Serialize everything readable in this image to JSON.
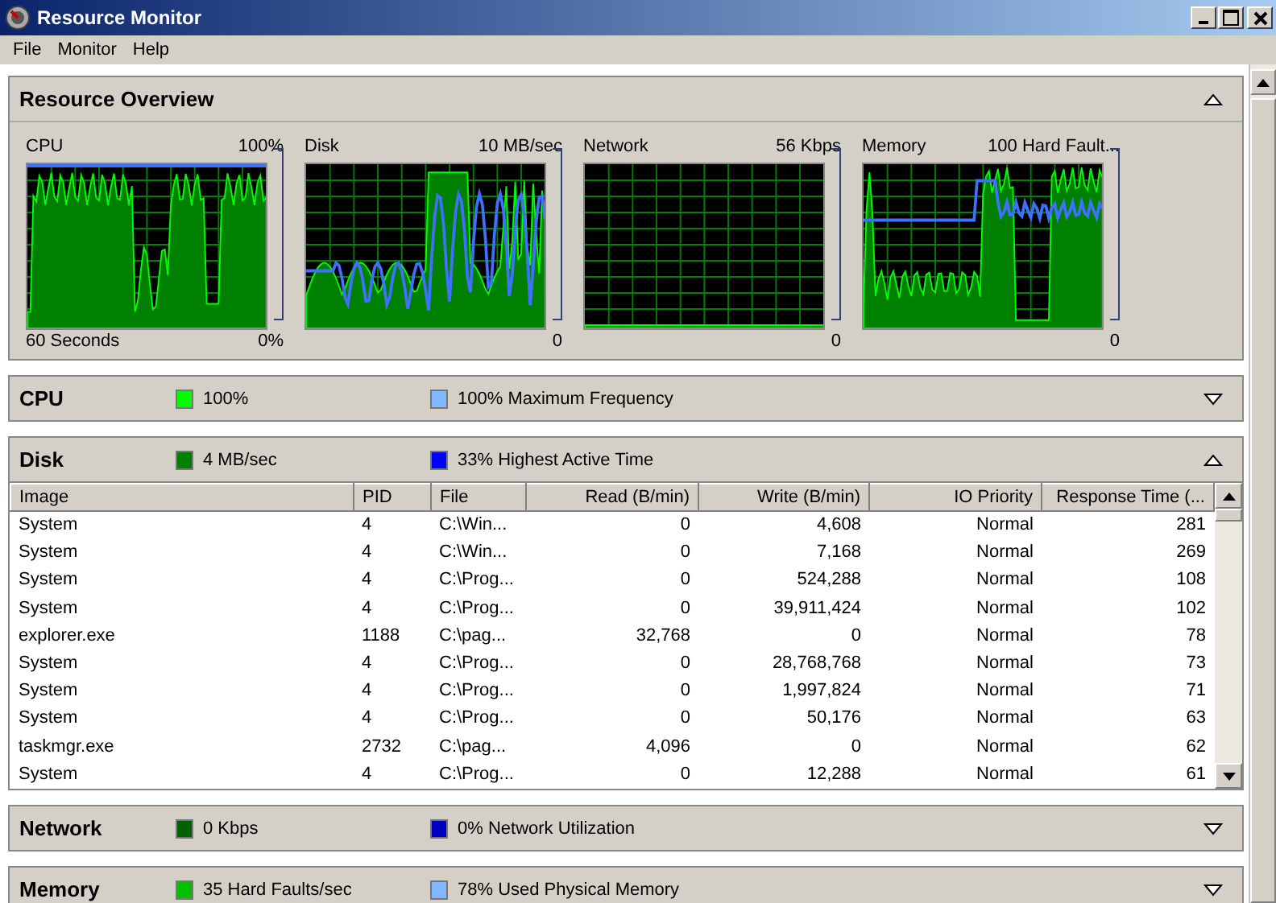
{
  "window": {
    "title": "Resource Monitor"
  },
  "menu": [
    "File",
    "Monitor",
    "Help"
  ],
  "overview": {
    "title": "Resource Overview",
    "expanded": true,
    "graphs": [
      {
        "title": "CPU",
        "max": "100%",
        "time": "60 Seconds",
        "min": "0%"
      },
      {
        "title": "Disk",
        "max": "10 MB/sec",
        "min": "0"
      },
      {
        "title": "Network",
        "max": "56 Kbps",
        "min": "0"
      },
      {
        "title": "Memory",
        "max": "100 Hard Fault...",
        "min": "0"
      }
    ]
  },
  "sections": [
    {
      "title": "CPU",
      "expanded": false,
      "legend": [
        {
          "text": "100%",
          "color": "#00ff00"
        },
        {
          "text": "100% Maximum Frequency",
          "color": "#80b8ff"
        }
      ]
    },
    {
      "title": "Disk",
      "expanded": true,
      "legend": [
        {
          "text": "4 MB/sec",
          "color": "#008000"
        },
        {
          "text": "33% Highest Active Time",
          "color": "#0000ff"
        }
      ],
      "table": {
        "columns": [
          "Image",
          "PID",
          "File",
          "Read (B/min)",
          "Write (B/min)",
          "IO Priority",
          "Response Time (..."
        ],
        "rows": [
          [
            "System",
            "4",
            "C:\\Win...",
            "0",
            "4,608",
            "Normal",
            "281"
          ],
          [
            "System",
            "4",
            "C:\\Win...",
            "0",
            "7,168",
            "Normal",
            "269"
          ],
          [
            "System",
            "4",
            "C:\\Prog...",
            "0",
            "524,288",
            "Normal",
            "108"
          ],
          [
            "System",
            "4",
            "C:\\Prog...",
            "0",
            "39,911,424",
            "Normal",
            "102"
          ],
          [
            "explorer.exe",
            "1188",
            "C:\\pag...",
            "32,768",
            "0",
            "Normal",
            "78"
          ],
          [
            "System",
            "4",
            "C:\\Prog...",
            "0",
            "28,768,768",
            "Normal",
            "73"
          ],
          [
            "System",
            "4",
            "C:\\Prog...",
            "0",
            "1,997,824",
            "Normal",
            "71"
          ],
          [
            "System",
            "4",
            "C:\\Prog...",
            "0",
            "50,176",
            "Normal",
            "63"
          ],
          [
            "taskmgr.exe",
            "2732",
            "C:\\pag...",
            "4,096",
            "0",
            "Normal",
            "62"
          ],
          [
            "System",
            "4",
            "C:\\Prog...",
            "0",
            "12,288",
            "Normal",
            "61"
          ]
        ]
      }
    },
    {
      "title": "Network",
      "expanded": false,
      "legend": [
        {
          "text": "0 Kbps",
          "color": "#006000"
        },
        {
          "text": "0% Network Utilization",
          "color": "#0000c0"
        }
      ]
    },
    {
      "title": "Memory",
      "expanded": false,
      "legend": [
        {
          "text": "35 Hard Faults/sec",
          "color": "#00c000"
        },
        {
          "text": "78% Used Physical Memory",
          "color": "#80b8ff"
        }
      ]
    }
  ]
}
